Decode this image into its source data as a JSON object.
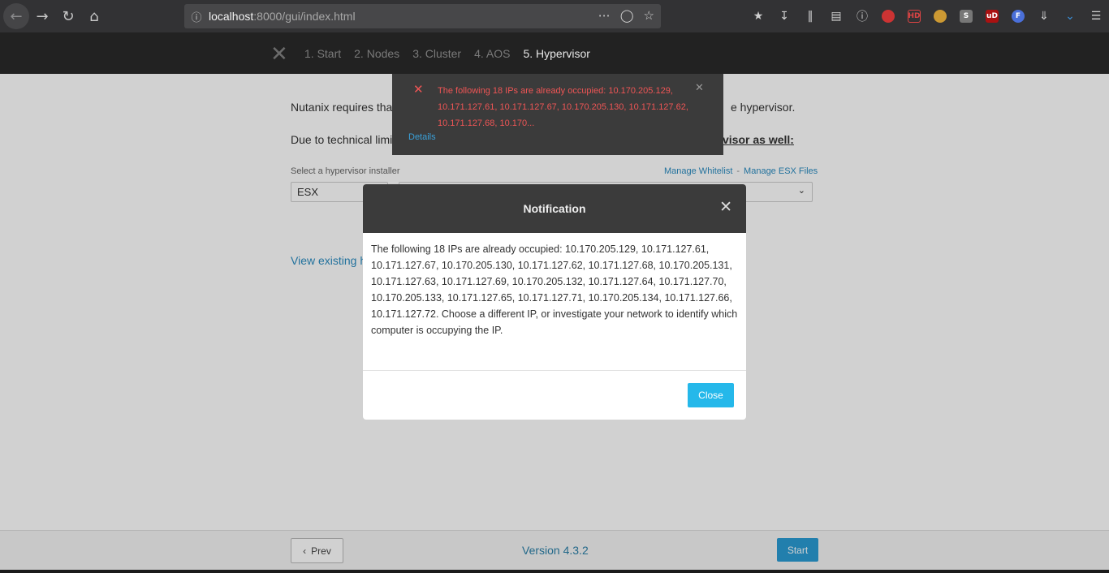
{
  "browser": {
    "url_host": "localhost",
    "url_path": ":8000/gui/index.html"
  },
  "nav": {
    "steps": [
      "1. Start",
      "2. Nodes",
      "3. Cluster",
      "4. AOS",
      "5. Hypervisor"
    ]
  },
  "page": {
    "para1_left": "Nutanix requires tha",
    "para1_right": "e hypervisor.",
    "para2_left": "Due to technical limi",
    "para2_right": "visor as well",
    "para2_colon": ":",
    "select_label": "Select a hypervisor installer",
    "manage_whitelist": "Manage Whitelist",
    "link_separator": "-",
    "manage_esx": "Manage ESX Files",
    "selected_hypervisor": "ESX",
    "view_link": "View existing h"
  },
  "toast": {
    "message": "The following 18 IPs are already occupied: 10.170.205.129, 10.171.127.61, 10.171.127.67, 10.170.205.130, 10.171.127.62, 10.171.127.68, 10.170...",
    "details": "Details"
  },
  "modal": {
    "title": "Notification",
    "body": "The following 18 IPs are already occupied: 10.170.205.129, 10.171.127.61, 10.171.127.67, 10.170.205.130, 10.171.127.62, 10.171.127.68, 10.170.205.131, 10.171.127.63, 10.171.127.69, 10.170.205.132, 10.171.127.64, 10.171.127.70, 10.170.205.133, 10.171.127.65, 10.171.127.71, 10.170.205.134, 10.171.127.66, 10.171.127.72. Choose a different IP, or investigate your network to identify which computer is occupying the IP.",
    "close_label": "Close"
  },
  "footer": {
    "prev_label": "Prev",
    "version": "Version 4.3.2",
    "start_label": "Start"
  },
  "colors": {
    "accent": "#2a9bd4",
    "error": "#e55555",
    "header": "#222222"
  }
}
